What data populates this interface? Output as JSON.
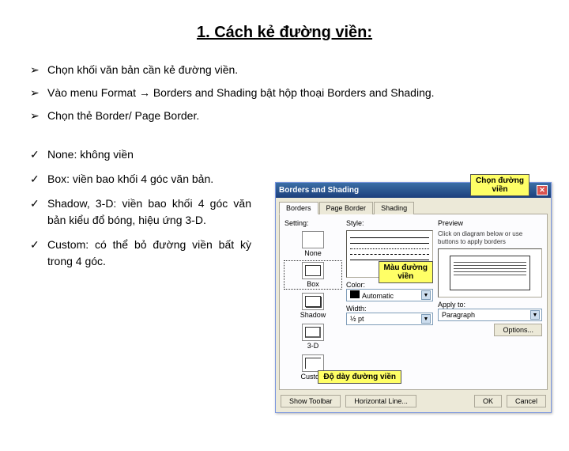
{
  "title": "1. Cách kẻ đường viền:",
  "steps": [
    "Chọn khối văn bản cần kẻ đường viền.",
    "Vào menu Format → Borders and Shading bật hộp thoại Borders and Shading.",
    "Chọn thẻ Border/ Page Border."
  ],
  "options": [
    "None: không viền",
    "Box: viền bao khối 4 góc văn bản.",
    "Shadow, 3-D: viền bao khối 4 góc văn bản kiểu đổ bóng, hiệu ứng 3-D.",
    "Custom: có thể bỏ đường viền bất kỳ trong 4 góc."
  ],
  "callouts": {
    "c1_l1": "Chọn đường",
    "c1_l2": "viền",
    "c2_l1": "Màu đường",
    "c2_l2": "viền",
    "c3": "Độ dày đường viền"
  },
  "dialog": {
    "title": "Borders and Shading",
    "tabs": [
      "Borders",
      "Page Border",
      "Shading"
    ],
    "section_setting": "Setting:",
    "section_style": "Style:",
    "section_preview": "Preview",
    "settings": {
      "none": "None",
      "box": "Box",
      "shadow": "Shadow",
      "threed": "3-D",
      "custom": "Custom"
    },
    "color_label": "Color:",
    "color_value": "Automatic",
    "width_label": "Width:",
    "width_value": "½ pt",
    "preview_hint": "Click on diagram below or use buttons to apply borders",
    "apply_label": "Apply to:",
    "apply_value": "Paragraph",
    "options_btn": "Options...",
    "show_toolbar": "Show Toolbar",
    "horiz_line": "Horizontal Line...",
    "ok": "OK",
    "cancel": "Cancel"
  }
}
